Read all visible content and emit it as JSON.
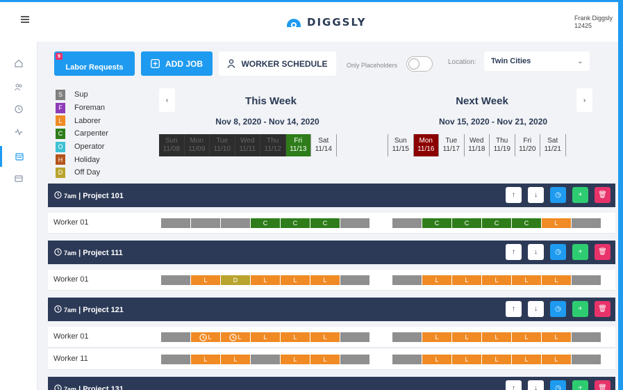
{
  "header": {
    "brand": "DIGGSLY",
    "user_name": "Frank Diggsly",
    "user_id": "12425"
  },
  "toolbar": {
    "labor_label": "Labor Requests",
    "labor_badge": "9",
    "add_label": "ADD JOB",
    "schedule_label": "WORKER SCHEDULE",
    "placeholders_label": "Only Placeholders",
    "location_label": "Location:",
    "location_value": "Twin Cities"
  },
  "legend": [
    {
      "code": "S",
      "label": "Sup",
      "color": "#7f7f7f"
    },
    {
      "code": "F",
      "label": "Foreman",
      "color": "#8e3bb8"
    },
    {
      "code": "L",
      "label": "Laborer",
      "color": "#f08a24"
    },
    {
      "code": "C",
      "label": "Carpenter",
      "color": "#2e7d1a"
    },
    {
      "code": "O",
      "label": "Operator",
      "color": "#3ec1d3"
    },
    {
      "code": "H",
      "label": "Holiday",
      "color": "#b5541c"
    },
    {
      "code": "D",
      "label": "Off Day",
      "color": "#b8a42e"
    }
  ],
  "this_week": {
    "title": "This Week",
    "range": "Nov 8, 2020 - Nov 14, 2020",
    "days": [
      {
        "dow": "Sun",
        "date": "11/08",
        "state": "past"
      },
      {
        "dow": "Mon",
        "date": "11/09",
        "state": "past"
      },
      {
        "dow": "Tue",
        "date": "11/10",
        "state": "past"
      },
      {
        "dow": "Wed",
        "date": "11/11",
        "state": "past"
      },
      {
        "dow": "Thu",
        "date": "11/12",
        "state": "past"
      },
      {
        "dow": "Fri",
        "date": "11/13",
        "state": "today"
      },
      {
        "dow": "Sat",
        "date": "11/14",
        "state": ""
      }
    ]
  },
  "next_week": {
    "title": "Next Week",
    "range": "Nov 15, 2020 - Nov 21, 2020",
    "days": [
      {
        "dow": "Sun",
        "date": "11/15",
        "state": ""
      },
      {
        "dow": "Mon",
        "date": "11/16",
        "state": "hl"
      },
      {
        "dow": "Tue",
        "date": "11/17",
        "state": ""
      },
      {
        "dow": "Wed",
        "date": "11/18",
        "state": ""
      },
      {
        "dow": "Thu",
        "date": "11/19",
        "state": ""
      },
      {
        "dow": "Fri",
        "date": "11/20",
        "state": ""
      },
      {
        "dow": "Sat",
        "date": "11/21",
        "state": ""
      }
    ]
  },
  "projects": [
    {
      "time": "7am",
      "name": "Project 101",
      "workers": [
        {
          "name": "Worker 01",
          "this": [
            "x",
            "x",
            "x",
            "C",
            "C",
            "C",
            "x"
          ],
          "next": [
            "x",
            "C",
            "C",
            "C",
            "C",
            "L",
            "x"
          ]
        }
      ]
    },
    {
      "time": "7am",
      "name": "Project 111",
      "workers": [
        {
          "name": "Worker 01",
          "this": [
            "x",
            "L",
            "D",
            "L",
            "L",
            "L",
            "x"
          ],
          "next": [
            "x",
            "L",
            "L",
            "L",
            "L",
            "L",
            "x"
          ]
        }
      ]
    },
    {
      "time": "7am",
      "name": "Project 121",
      "workers": [
        {
          "name": "Worker 01",
          "this": [
            "x",
            "L*",
            "L*",
            "L",
            "L",
            "L",
            "x"
          ],
          "next": [
            "x",
            "L",
            "L",
            "L",
            "L",
            "L",
            "x"
          ]
        },
        {
          "name": "Worker 11",
          "this": [
            "x",
            "L",
            "L",
            "x",
            "L",
            "L",
            "x"
          ],
          "next": [
            "x",
            "L",
            "L",
            "L",
            "L",
            "L",
            "x"
          ]
        }
      ]
    },
    {
      "time": "7am",
      "name": "Project 131",
      "workers": []
    }
  ]
}
